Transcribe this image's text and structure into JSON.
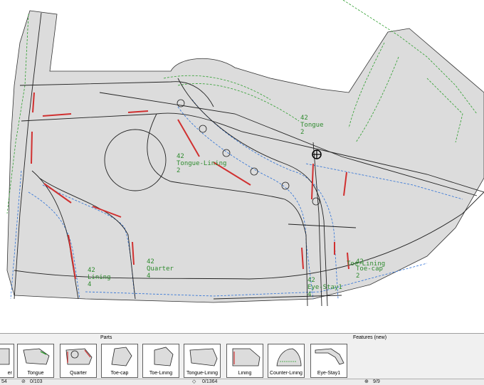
{
  "canvas": {
    "labels": [
      {
        "name": "tongue-label",
        "lines": [
          "42",
          "Tongue",
          "2"
        ]
      },
      {
        "name": "tongue-lining-label",
        "lines": [
          "42",
          "Tongue-Lining",
          "2"
        ]
      },
      {
        "name": "quarter-label",
        "lines": [
          "42",
          "Quarter",
          "4"
        ]
      },
      {
        "name": "lining-label",
        "lines": [
          "42",
          "Lining",
          "4"
        ]
      },
      {
        "name": "eye-stay-label",
        "lines": [
          "42",
          "Eye-Stay1",
          "4"
        ]
      },
      {
        "name": "toe-lining-label",
        "lines": [
          "42",
          "Toe-Lining",
          "2"
        ]
      },
      {
        "name": "toe-cap-label",
        "lines": [
          "Toe-cap"
        ]
      }
    ]
  },
  "panel": {
    "parts_title": "Parts",
    "features_title": "Features (new)",
    "parts": [
      {
        "label": "er"
      },
      {
        "label": "Tongue"
      },
      {
        "label": "Quarter"
      },
      {
        "label": "Toe-cap"
      },
      {
        "label": "Toe-Lining"
      },
      {
        "label": "Tongue-Lining"
      },
      {
        "label": "Lining"
      },
      {
        "label": "Counter-Lining"
      },
      {
        "label": "Eye-Stay1"
      }
    ]
  },
  "status": {
    "s1": "54",
    "s2": "0/103",
    "s3": "0/1364",
    "s4": "9/9"
  },
  "colors": {
    "part_fill": "#dcdcdc",
    "outline": "#222222",
    "green": "#2e9e2e",
    "blue": "#2a6fd6",
    "red": "#d03030"
  }
}
